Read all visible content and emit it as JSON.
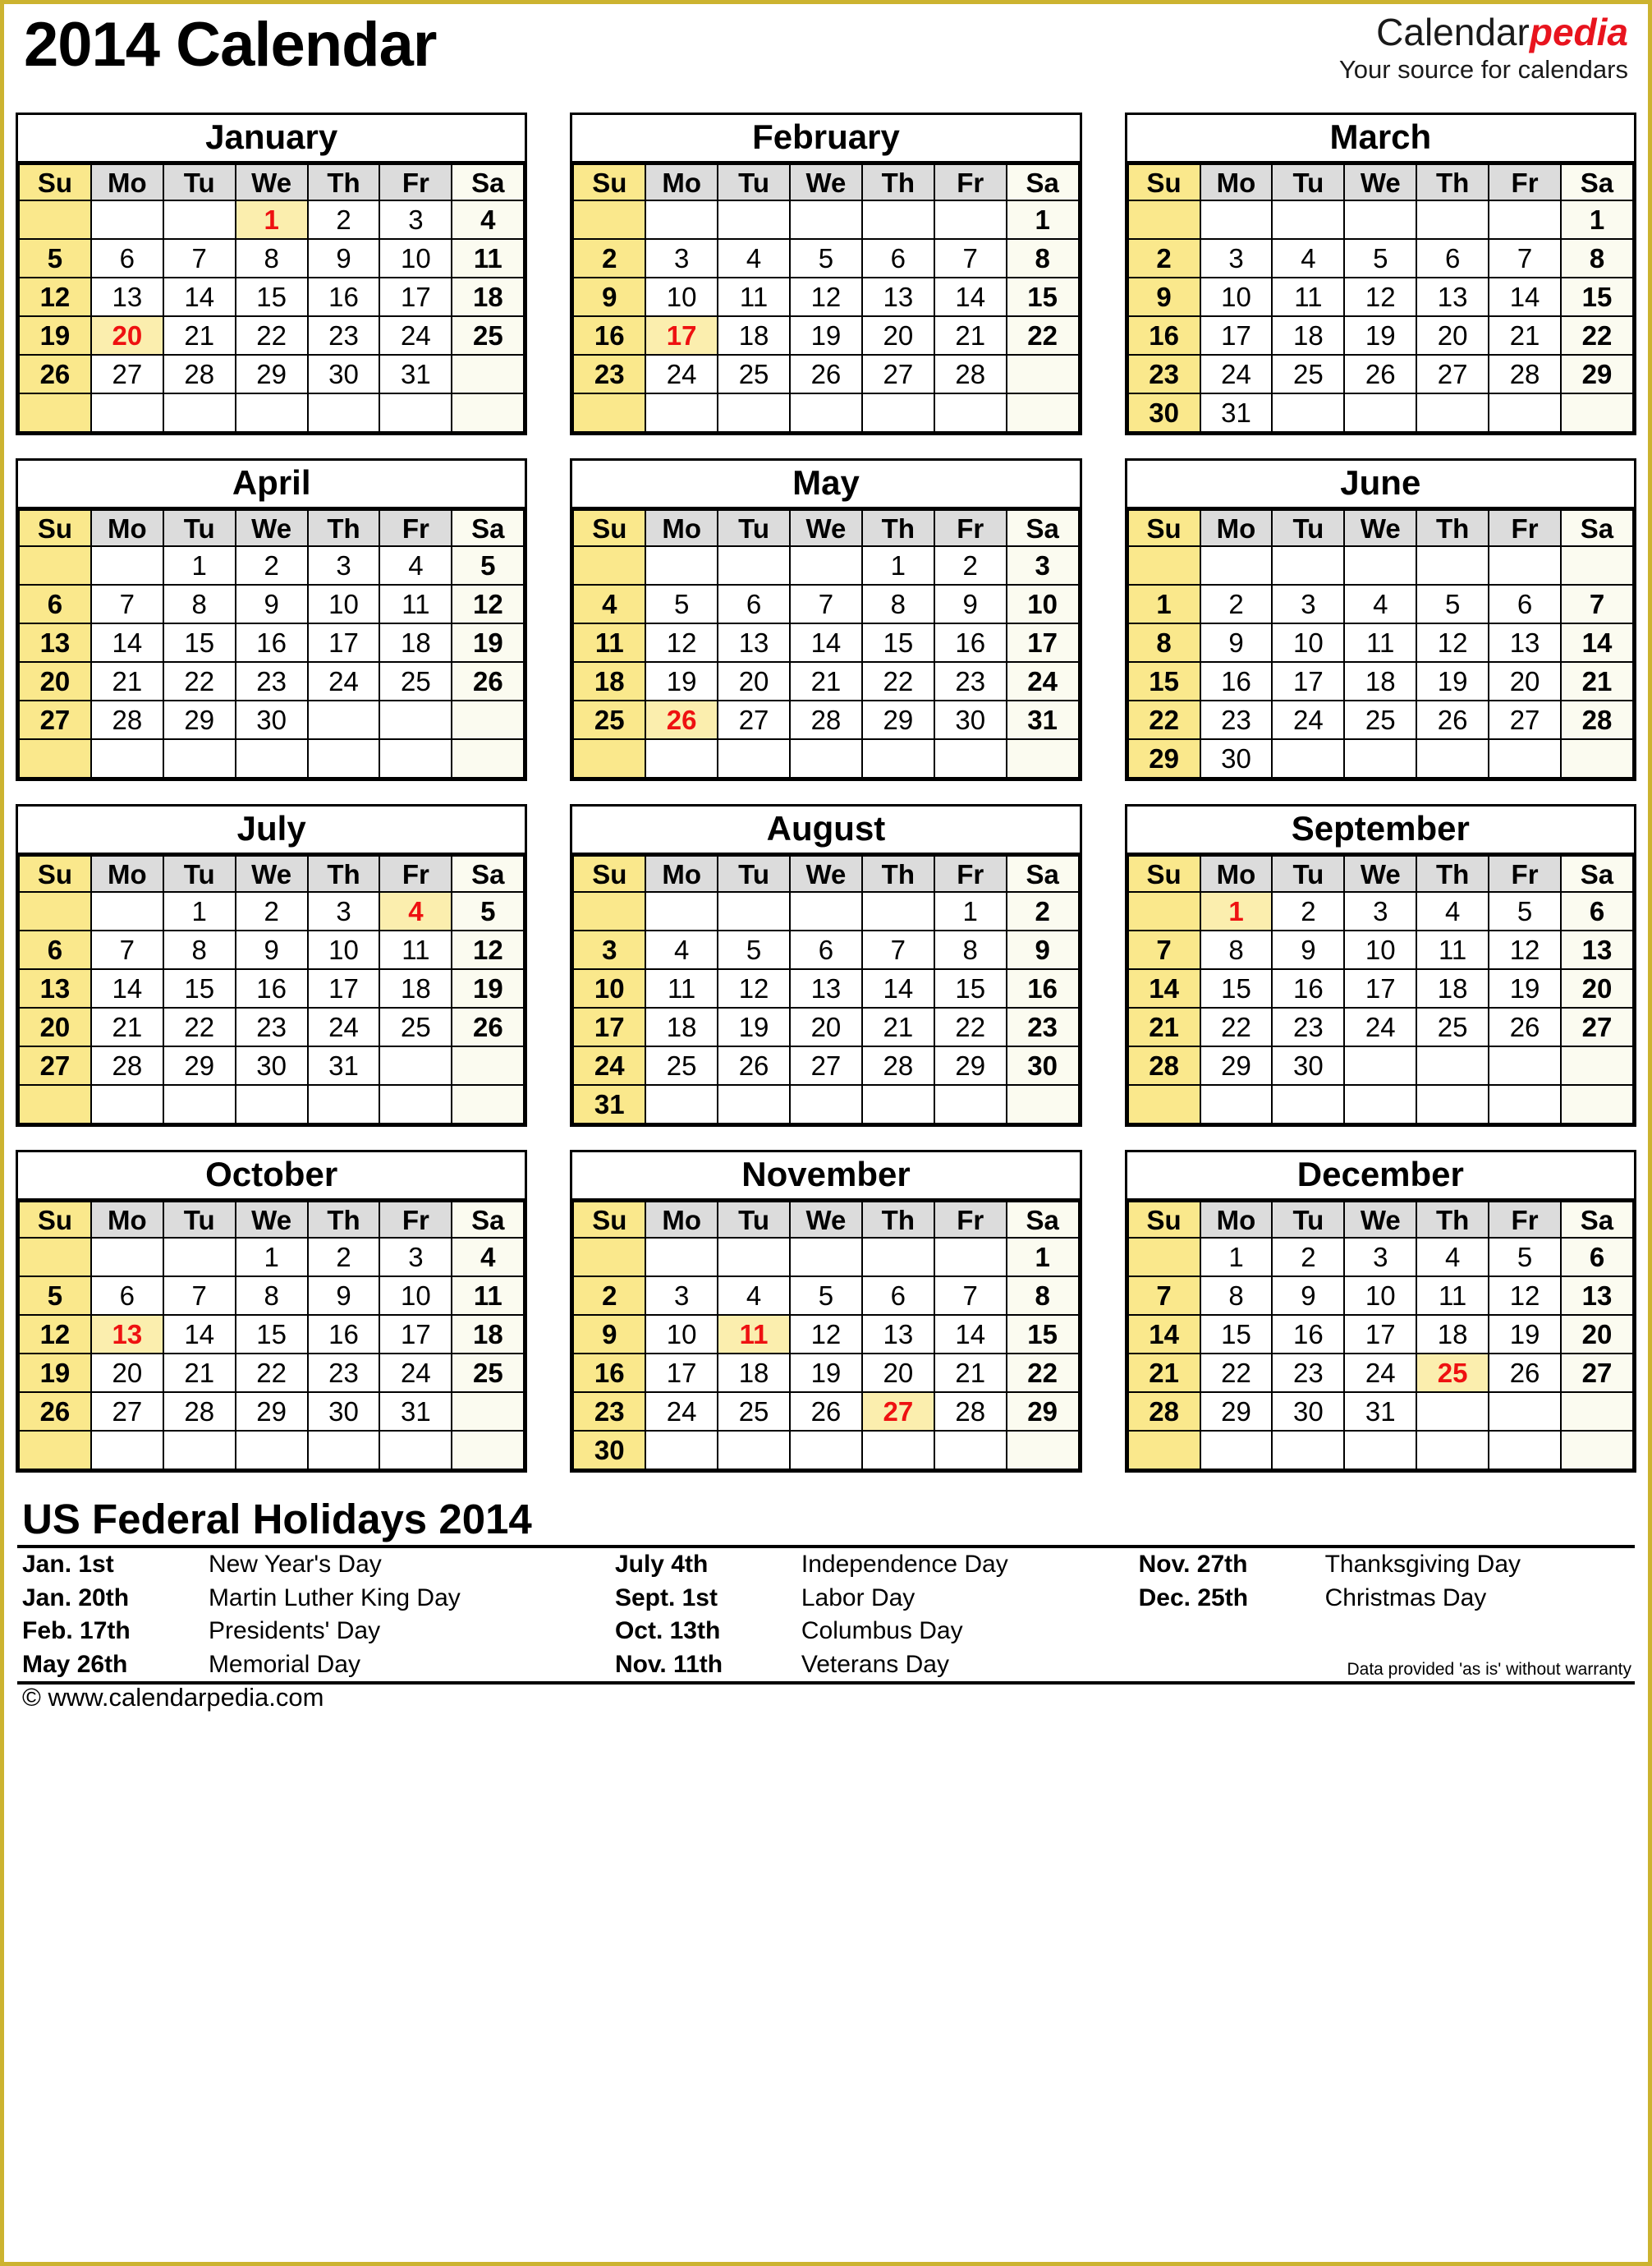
{
  "header": {
    "title": "2014 Calendar",
    "brand_name_part1": "Calendar",
    "brand_name_part2": "pedia",
    "brand_tagline": "Your source for calendars"
  },
  "weekday_headers": [
    "Su",
    "Mo",
    "Tu",
    "We",
    "Th",
    "Fr",
    "Sa"
  ],
  "colors": {
    "sunday_bg": "#fae88c",
    "saturday_bg": "#fbfbf0",
    "weekday_header_bg": "#dcdcdc",
    "holiday_bg": "#fbeeae",
    "holiday_text": "#ee1111",
    "brand_accent": "#e8141e",
    "page_border": "#ccb330"
  },
  "months": [
    {
      "name": "January",
      "weeks": [
        [
          null,
          null,
          null,
          1,
          2,
          3,
          4
        ],
        [
          5,
          6,
          7,
          8,
          9,
          10,
          11
        ],
        [
          12,
          13,
          14,
          15,
          16,
          17,
          18
        ],
        [
          19,
          20,
          21,
          22,
          23,
          24,
          25
        ],
        [
          26,
          27,
          28,
          29,
          30,
          31,
          null
        ],
        [
          null,
          null,
          null,
          null,
          null,
          null,
          null
        ]
      ],
      "holidays": [
        1,
        20
      ]
    },
    {
      "name": "February",
      "weeks": [
        [
          null,
          null,
          null,
          null,
          null,
          null,
          1
        ],
        [
          2,
          3,
          4,
          5,
          6,
          7,
          8
        ],
        [
          9,
          10,
          11,
          12,
          13,
          14,
          15
        ],
        [
          16,
          17,
          18,
          19,
          20,
          21,
          22
        ],
        [
          23,
          24,
          25,
          26,
          27,
          28,
          null
        ],
        [
          null,
          null,
          null,
          null,
          null,
          null,
          null
        ]
      ],
      "holidays": [
        17
      ]
    },
    {
      "name": "March",
      "weeks": [
        [
          null,
          null,
          null,
          null,
          null,
          null,
          1
        ],
        [
          2,
          3,
          4,
          5,
          6,
          7,
          8
        ],
        [
          9,
          10,
          11,
          12,
          13,
          14,
          15
        ],
        [
          16,
          17,
          18,
          19,
          20,
          21,
          22
        ],
        [
          23,
          24,
          25,
          26,
          27,
          28,
          29
        ],
        [
          30,
          31,
          null,
          null,
          null,
          null,
          null
        ]
      ],
      "holidays": []
    },
    {
      "name": "April",
      "weeks": [
        [
          null,
          null,
          1,
          2,
          3,
          4,
          5
        ],
        [
          6,
          7,
          8,
          9,
          10,
          11,
          12
        ],
        [
          13,
          14,
          15,
          16,
          17,
          18,
          19
        ],
        [
          20,
          21,
          22,
          23,
          24,
          25,
          26
        ],
        [
          27,
          28,
          29,
          30,
          null,
          null,
          null
        ],
        [
          null,
          null,
          null,
          null,
          null,
          null,
          null
        ]
      ],
      "holidays": []
    },
    {
      "name": "May",
      "weeks": [
        [
          null,
          null,
          null,
          null,
          1,
          2,
          3
        ],
        [
          4,
          5,
          6,
          7,
          8,
          9,
          10
        ],
        [
          11,
          12,
          13,
          14,
          15,
          16,
          17
        ],
        [
          18,
          19,
          20,
          21,
          22,
          23,
          24
        ],
        [
          25,
          26,
          27,
          28,
          29,
          30,
          31
        ],
        [
          null,
          null,
          null,
          null,
          null,
          null,
          null
        ]
      ],
      "holidays": [
        26
      ]
    },
    {
      "name": "June",
      "weeks": [
        [
          null,
          null,
          null,
          null,
          null,
          null,
          null
        ],
        [
          1,
          2,
          3,
          4,
          5,
          6,
          7
        ],
        [
          8,
          9,
          10,
          11,
          12,
          13,
          14
        ],
        [
          15,
          16,
          17,
          18,
          19,
          20,
          21
        ],
        [
          22,
          23,
          24,
          25,
          26,
          27,
          28
        ],
        [
          29,
          30,
          null,
          null,
          null,
          null,
          null
        ]
      ],
      "holidays": []
    },
    {
      "name": "July",
      "weeks": [
        [
          null,
          null,
          1,
          2,
          3,
          4,
          5
        ],
        [
          6,
          7,
          8,
          9,
          10,
          11,
          12
        ],
        [
          13,
          14,
          15,
          16,
          17,
          18,
          19
        ],
        [
          20,
          21,
          22,
          23,
          24,
          25,
          26
        ],
        [
          27,
          28,
          29,
          30,
          31,
          null,
          null
        ],
        [
          null,
          null,
          null,
          null,
          null,
          null,
          null
        ]
      ],
      "holidays": [
        4
      ]
    },
    {
      "name": "August",
      "weeks": [
        [
          null,
          null,
          null,
          null,
          null,
          1,
          2
        ],
        [
          3,
          4,
          5,
          6,
          7,
          8,
          9
        ],
        [
          10,
          11,
          12,
          13,
          14,
          15,
          16
        ],
        [
          17,
          18,
          19,
          20,
          21,
          22,
          23
        ],
        [
          24,
          25,
          26,
          27,
          28,
          29,
          30
        ],
        [
          31,
          null,
          null,
          null,
          null,
          null,
          null
        ]
      ],
      "holidays": []
    },
    {
      "name": "September",
      "weeks": [
        [
          null,
          1,
          2,
          3,
          4,
          5,
          6
        ],
        [
          7,
          8,
          9,
          10,
          11,
          12,
          13
        ],
        [
          14,
          15,
          16,
          17,
          18,
          19,
          20
        ],
        [
          21,
          22,
          23,
          24,
          25,
          26,
          27
        ],
        [
          28,
          29,
          30,
          null,
          null,
          null,
          null
        ],
        [
          null,
          null,
          null,
          null,
          null,
          null,
          null
        ]
      ],
      "holidays": [
        1
      ]
    },
    {
      "name": "October",
      "weeks": [
        [
          null,
          null,
          null,
          1,
          2,
          3,
          4
        ],
        [
          5,
          6,
          7,
          8,
          9,
          10,
          11
        ],
        [
          12,
          13,
          14,
          15,
          16,
          17,
          18
        ],
        [
          19,
          20,
          21,
          22,
          23,
          24,
          25
        ],
        [
          26,
          27,
          28,
          29,
          30,
          31,
          null
        ],
        [
          null,
          null,
          null,
          null,
          null,
          null,
          null
        ]
      ],
      "holidays": [
        13
      ]
    },
    {
      "name": "November",
      "weeks": [
        [
          null,
          null,
          null,
          null,
          null,
          null,
          1
        ],
        [
          2,
          3,
          4,
          5,
          6,
          7,
          8
        ],
        [
          9,
          10,
          11,
          12,
          13,
          14,
          15
        ],
        [
          16,
          17,
          18,
          19,
          20,
          21,
          22
        ],
        [
          23,
          24,
          25,
          26,
          27,
          28,
          29
        ],
        [
          30,
          null,
          null,
          null,
          null,
          null,
          null
        ]
      ],
      "holidays": [
        11,
        27
      ]
    },
    {
      "name": "December",
      "weeks": [
        [
          null,
          1,
          2,
          3,
          4,
          5,
          6
        ],
        [
          7,
          8,
          9,
          10,
          11,
          12,
          13
        ],
        [
          14,
          15,
          16,
          17,
          18,
          19,
          20
        ],
        [
          21,
          22,
          23,
          24,
          25,
          26,
          27
        ],
        [
          28,
          29,
          30,
          31,
          null,
          null,
          null
        ],
        [
          null,
          null,
          null,
          null,
          null,
          null,
          null
        ]
      ],
      "holidays": [
        25
      ]
    }
  ],
  "holidays_section": {
    "title": "US Federal Holidays 2014",
    "rows": [
      [
        {
          "date": "Jan. 1st",
          "name": "New Year's Day"
        },
        {
          "date": "July 4th",
          "name": "Independence Day"
        },
        {
          "date": "Nov. 27th",
          "name": "Thanksgiving Day"
        }
      ],
      [
        {
          "date": "Jan. 20th",
          "name": "Martin Luther King Day"
        },
        {
          "date": "Sept. 1st",
          "name": "Labor Day"
        },
        {
          "date": "Dec. 25th",
          "name": "Christmas Day"
        }
      ],
      [
        {
          "date": "Feb. 17th",
          "name": "Presidents' Day"
        },
        {
          "date": "Oct. 13th",
          "name": "Columbus Day"
        },
        {
          "date": "",
          "name": ""
        }
      ],
      [
        {
          "date": "May 26th",
          "name": "Memorial Day"
        },
        {
          "date": "Nov. 11th",
          "name": "Veterans Day"
        },
        {
          "date": "",
          "name": ""
        }
      ]
    ]
  },
  "footer": {
    "copyright": "© www.calendarpedia.com",
    "disclaimer": "Data provided 'as is' without warranty"
  }
}
